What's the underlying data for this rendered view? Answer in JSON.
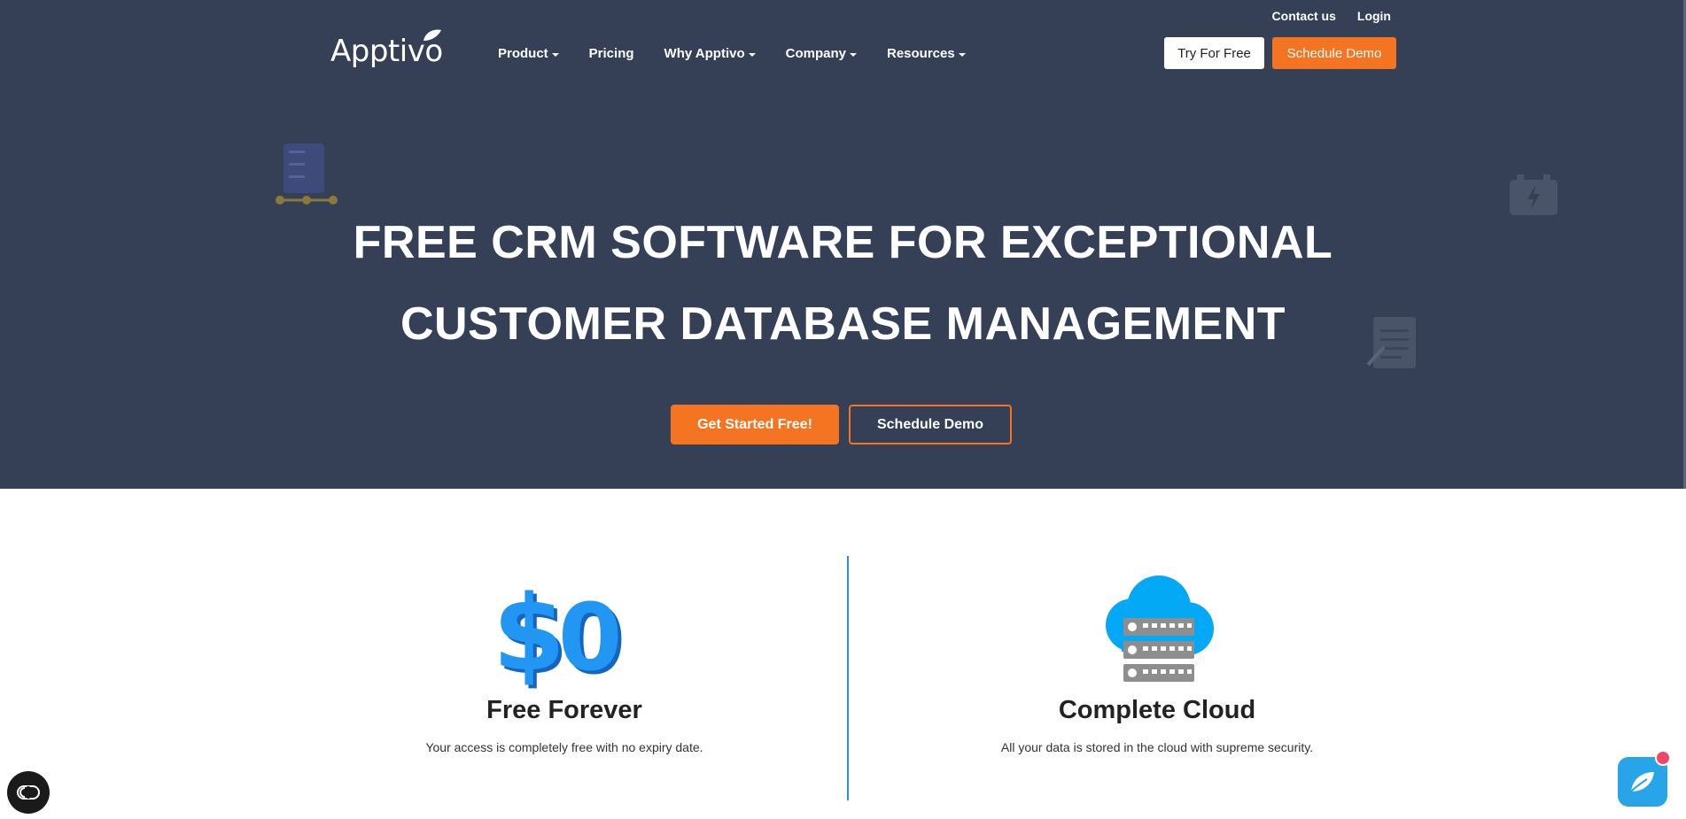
{
  "header": {
    "logo_text": "Apptivo",
    "utility_links": [
      "Contact us",
      "Login"
    ],
    "nav": [
      {
        "label": "Product",
        "dropdown": true
      },
      {
        "label": "Pricing",
        "dropdown": false
      },
      {
        "label": "Why Apptivo",
        "dropdown": true
      },
      {
        "label": "Company",
        "dropdown": true
      },
      {
        "label": "Resources",
        "dropdown": true
      }
    ],
    "try_label": "Try For Free",
    "demo_label": "Schedule Demo"
  },
  "hero": {
    "title_line1": "FREE CRM SOFTWARE FOR EXCEPTIONAL",
    "title_line2": "CUSTOMER DATABASE MANAGEMENT",
    "cta_primary": "Get Started Free!",
    "cta_secondary": "Schedule Demo"
  },
  "features": [
    {
      "icon": "dollar-zero-icon",
      "title": "Free Forever",
      "desc": "Your access is completely free with no expiry date."
    },
    {
      "icon": "cloud-server-icon",
      "title": "Complete Cloud",
      "desc": "All your data is stored in the cloud with supreme security."
    }
  ],
  "colors": {
    "hero_bg": "#354057",
    "accent": "#f47421",
    "divider": "#2d8fd6",
    "chat": "#28a5e8"
  },
  "widgets": {
    "accessibility_icon": "accessibility-icon",
    "chat_icon": "chat-leaf-icon"
  }
}
